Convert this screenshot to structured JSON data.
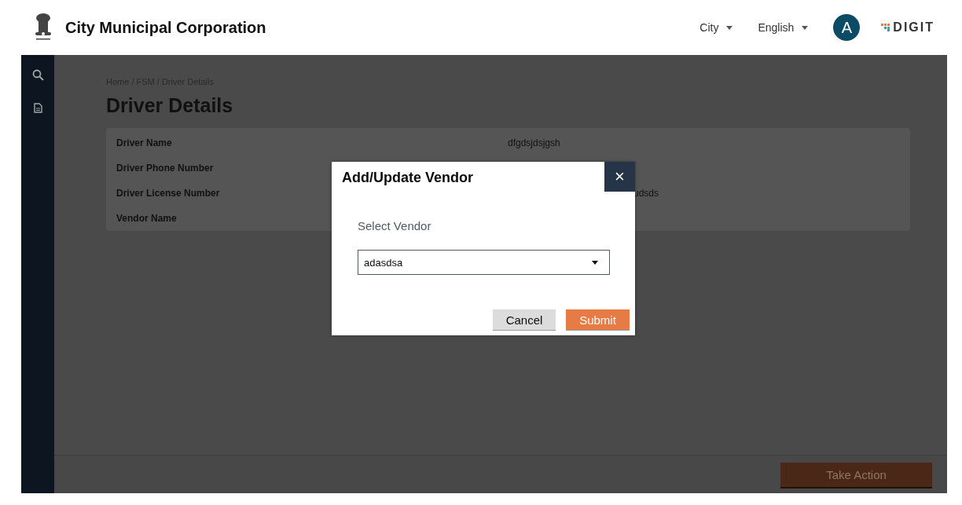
{
  "header": {
    "title": "City Municipal Corporation",
    "dropdowns": [
      {
        "label": "City"
      },
      {
        "label": "English"
      }
    ],
    "avatar": "A",
    "logo": "DIGIT"
  },
  "breadcrumb": "Home / FSM / Driver Details",
  "page_title": "Driver Details",
  "details": [
    {
      "label": "Driver Name",
      "value": "dfgdsjdsjgsh",
      "kind": "plain"
    },
    {
      "label": "Driver Phone Number",
      "kind": "covered"
    },
    {
      "label": "Driver License Number",
      "value": "udsds",
      "kind": "partly_covered"
    },
    {
      "label": "Vendor Name",
      "kind": "covered"
    }
  ],
  "footer": {
    "action": "Take Action"
  },
  "modal": {
    "title": "Add/Update Vendor",
    "close": "×",
    "field_label": "Select Vendor",
    "value": "adasdsa",
    "buttons": [
      {
        "label": "Cancel",
        "kind": "secondary"
      },
      {
        "label": "Submit",
        "kind": "primary"
      }
    ]
  }
}
